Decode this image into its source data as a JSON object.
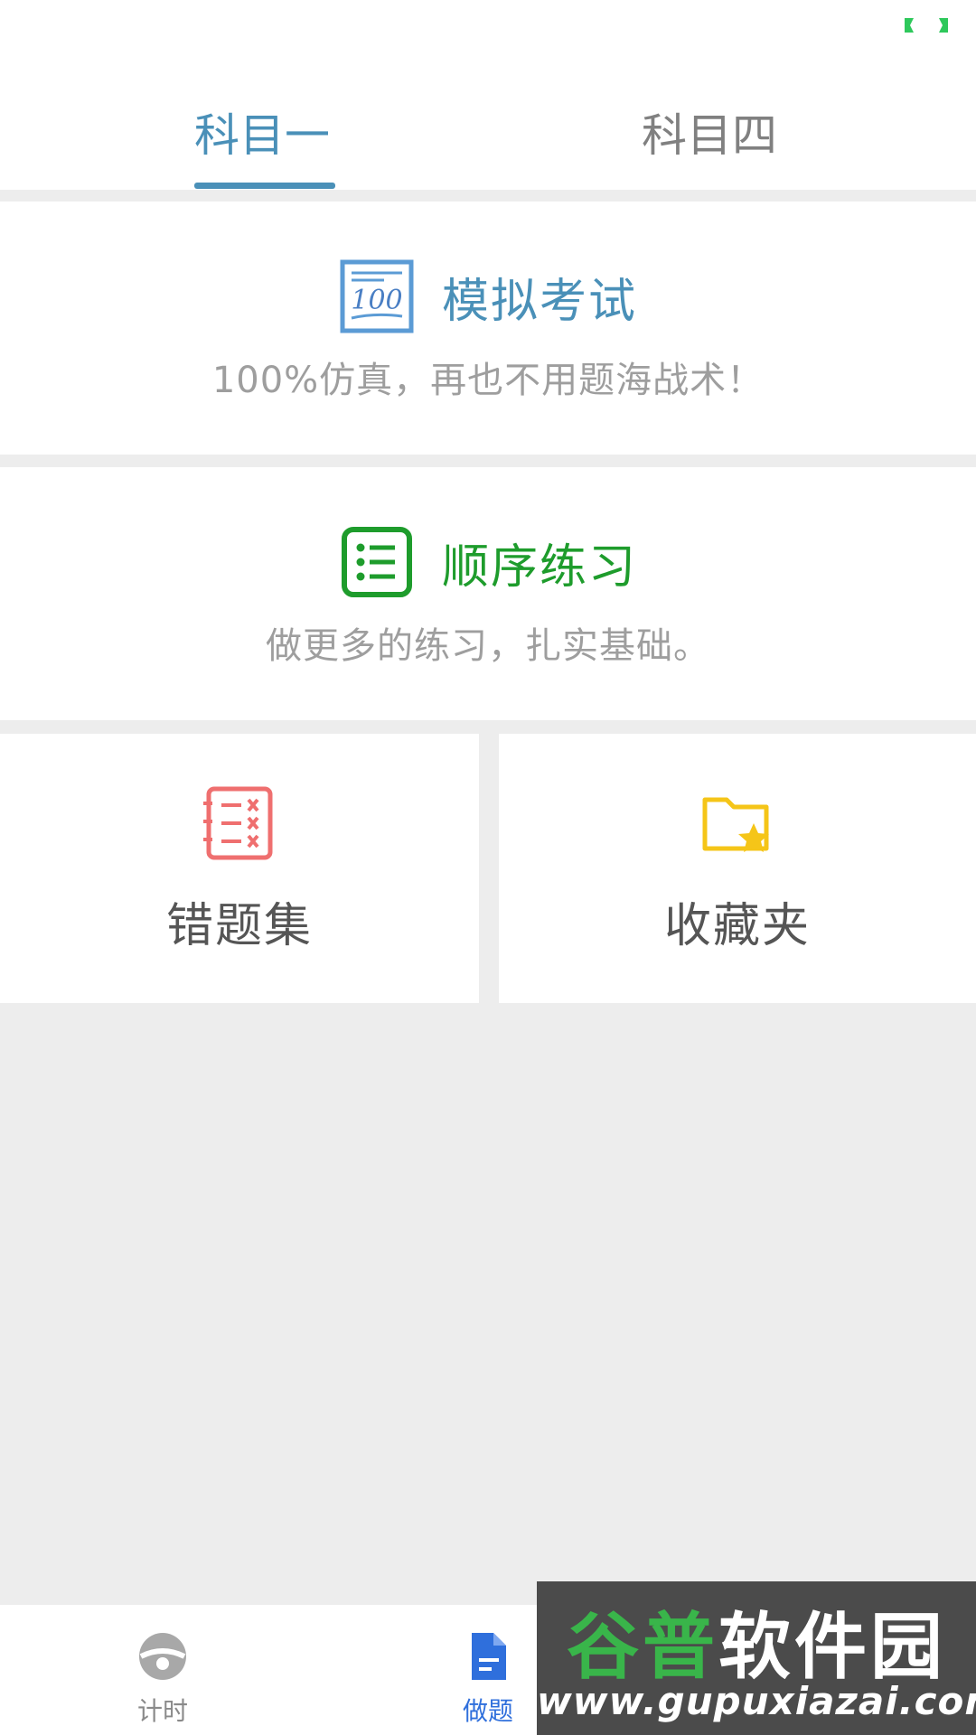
{
  "tabs": [
    {
      "label": "科目一",
      "active": true
    },
    {
      "label": "科目四",
      "active": false
    }
  ],
  "cards": {
    "exam": {
      "title": "模拟考试",
      "subtitle": "100%仿真，再也不用题海战术！",
      "icon": "exam-100-icon",
      "color": "#4a90b8"
    },
    "sequence": {
      "title": "顺序练习",
      "subtitle": "做更多的练习，扎实基础。",
      "icon": "list-icon",
      "color": "#1e9c2c"
    }
  },
  "tiles": {
    "wrong": {
      "label": "错题集",
      "icon": "wrong-notes-icon",
      "color": "#ef6f6f"
    },
    "favorites": {
      "label": "收藏夹",
      "icon": "star-folder-icon",
      "color": "#f5c518"
    }
  },
  "bottom_nav": {
    "items": [
      {
        "label": "计时",
        "icon": "steering-wheel-icon",
        "active": false
      },
      {
        "label": "做题",
        "icon": "document-icon",
        "active": true
      }
    ]
  },
  "watermark": {
    "cn_green": "谷普",
    "cn_white": "软件园",
    "url": "www.gupuxiazai.com"
  },
  "status": {
    "battery_icon": "battery-icon",
    "battery_color": "#2ec85b"
  }
}
